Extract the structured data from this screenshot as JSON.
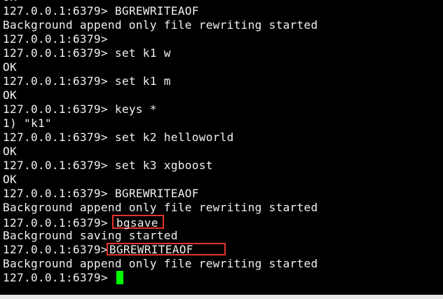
{
  "terminal": {
    "prompt": "127.0.0.1:6379>",
    "lines": [
      {
        "type": "output",
        "text": "OK"
      },
      {
        "type": "command",
        "cmd": "BGREWRITEAOF"
      },
      {
        "type": "output",
        "text": "Background append only file rewriting started"
      },
      {
        "type": "command",
        "cmd": ""
      },
      {
        "type": "command",
        "cmd": "set k1 w"
      },
      {
        "type": "output",
        "text": "OK"
      },
      {
        "type": "command",
        "cmd": "set k1 m"
      },
      {
        "type": "output",
        "text": "OK"
      },
      {
        "type": "command",
        "cmd": "keys *"
      },
      {
        "type": "output",
        "text": "1) \"k1\""
      },
      {
        "type": "command",
        "cmd": "set k2 helloworld"
      },
      {
        "type": "output",
        "text": "OK"
      },
      {
        "type": "command",
        "cmd": "set k3 xgboost"
      },
      {
        "type": "output",
        "text": "OK"
      },
      {
        "type": "command",
        "cmd": "BGREWRITEAOF"
      },
      {
        "type": "output",
        "text": "Background append only file rewriting started"
      },
      {
        "type": "command",
        "cmd": "bgsave",
        "highlight": true
      },
      {
        "type": "output",
        "text": "Background saving started"
      },
      {
        "type": "command",
        "cmd": "BGREWRITEAOF",
        "highlight": true
      },
      {
        "type": "output",
        "text": "Background append only file rewriting started"
      },
      {
        "type": "command",
        "cmd": "",
        "cursor": true
      }
    ]
  },
  "colors": {
    "background": "#000000",
    "text": "#f0f0f0",
    "highlight_border": "#e0342a",
    "cursor": "#00ff00"
  }
}
